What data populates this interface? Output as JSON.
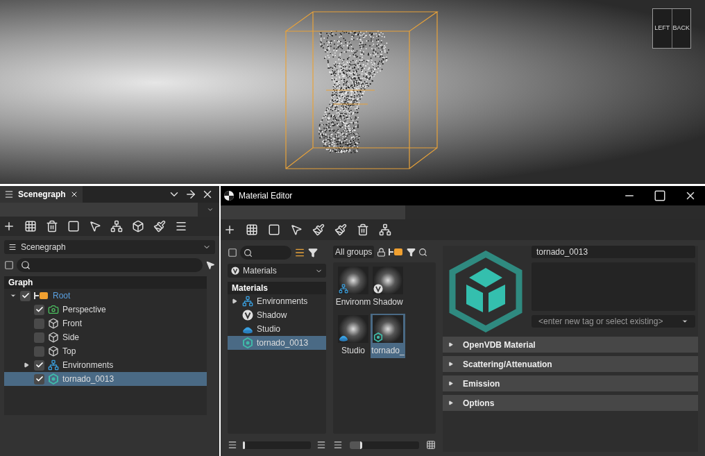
{
  "viewport": {
    "view_cube": {
      "faces": [
        "LEFT",
        "BACK"
      ]
    }
  },
  "scenegraph": {
    "tab": "Scenegraph",
    "view_select": "Scenegraph",
    "graph_header": "Graph",
    "tree": [
      {
        "label": "Root",
        "kind": "root",
        "checked": true,
        "expanded": true,
        "selected": false,
        "children": [
          {
            "label": "Perspective",
            "kind": "camera",
            "checked": true,
            "selected": false
          },
          {
            "label": "Front",
            "kind": "cube",
            "checked": false,
            "selected": false
          },
          {
            "label": "Side",
            "kind": "cube",
            "checked": false,
            "selected": false
          },
          {
            "label": "Top",
            "kind": "cube",
            "checked": false,
            "selected": false
          },
          {
            "label": "Environments",
            "kind": "environment",
            "checked": true,
            "expanded": false,
            "selected": false
          },
          {
            "label": "tornado_0013",
            "kind": "volume",
            "checked": true,
            "selected": true
          }
        ]
      }
    ]
  },
  "material_editor": {
    "title": "Material Editor",
    "materials_select": "Materials",
    "groups_select": "All groups",
    "tree_header": "Materials",
    "tree": [
      {
        "label": "Environments",
        "kind": "environment",
        "expanded": false,
        "selected": false
      },
      {
        "label": "Shadow",
        "kind": "vray",
        "selected": false
      },
      {
        "label": "Studio",
        "kind": "dome",
        "selected": false
      },
      {
        "label": "tornado_0013",
        "kind": "volume",
        "selected": true
      }
    ],
    "thumbnails": [
      {
        "label": "Environm",
        "kind": "environment",
        "selected": false
      },
      {
        "label": "Shadow",
        "kind": "vray",
        "selected": false
      },
      {
        "label": "Studio",
        "kind": "dome",
        "selected": false
      },
      {
        "label": "tornado_",
        "kind": "volume",
        "selected": true
      }
    ],
    "name_value": "tornado_0013",
    "tag_placeholder": "<enter new tag or select existing>",
    "sections": [
      {
        "label": "OpenVDB Material",
        "expanded": false
      },
      {
        "label": "Scattering/Attenuation",
        "expanded": false
      },
      {
        "label": "Emission",
        "expanded": false
      },
      {
        "label": "Options",
        "expanded": false
      }
    ],
    "list_slider": {
      "level": 0.02
    },
    "thumb_slider": {
      "level": 0.18
    }
  }
}
